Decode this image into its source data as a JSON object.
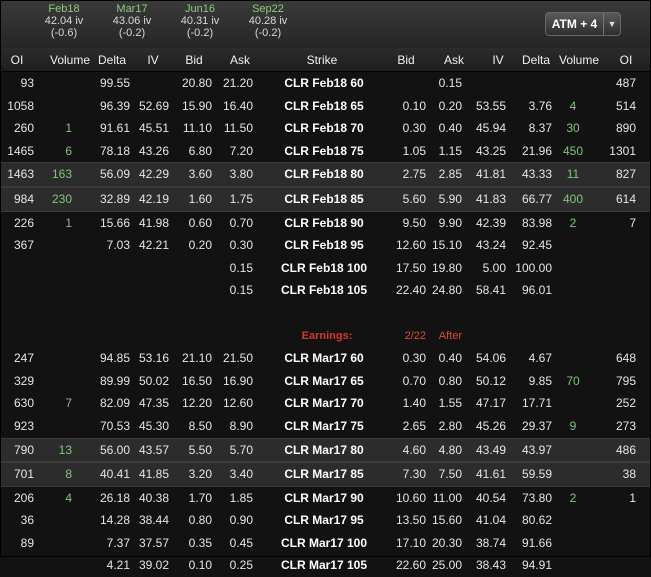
{
  "expirations": [
    {
      "month": "Feb18",
      "iv": "42.04 iv",
      "chg": "(-0.6)"
    },
    {
      "month": "Mar17",
      "iv": "43.06 iv",
      "chg": "(-0.2)"
    },
    {
      "month": "Jun16",
      "iv": "40.31 iv",
      "chg": "(-0.2)"
    },
    {
      "month": "Sep22",
      "iv": "40.28 iv",
      "chg": "(-0.2)"
    }
  ],
  "atm_button": {
    "label": "ATM + 4",
    "arrow": "▼"
  },
  "headers": {
    "oi": "OI",
    "volume": "Volume",
    "delta": "Delta",
    "iv": "IV",
    "bid": "Bid",
    "ask": "Ask",
    "strike": "Strike",
    "pbid": "Bid",
    "pask": "Ask",
    "piv": "IV",
    "pdelta": "Delta",
    "pvolume": "Volume",
    "poi": "OI"
  },
  "earnings": {
    "label": "Earnings:",
    "date": "2/22",
    "when": "After"
  },
  "rows_feb": [
    {
      "oi": "93",
      "vol": "",
      "delta": "99.55",
      "iv": "",
      "bid": "20.80",
      "ask": "21.20",
      "strike": "CLR Feb18 60",
      "pbid": "",
      "pask": "0.15",
      "piv": "",
      "pdelta": "",
      "pvol": "",
      "poi": "487"
    },
    {
      "oi": "1058",
      "vol": "",
      "delta": "96.39",
      "iv": "52.69",
      "bid": "15.90",
      "ask": "16.40",
      "strike": "CLR Feb18 65",
      "pbid": "0.10",
      "pask": "0.20",
      "piv": "53.55",
      "pdelta": "3.76",
      "pvol": "4",
      "poi": "514"
    },
    {
      "oi": "260",
      "vol": "1",
      "delta": "91.61",
      "iv": "45.51",
      "bid": "11.10",
      "ask": "11.50",
      "strike": "CLR Feb18 70",
      "pbid": "0.30",
      "pask": "0.40",
      "piv": "45.94",
      "pdelta": "8.37",
      "pvol": "30",
      "poi": "890"
    },
    {
      "oi": "1465",
      "vol": "6",
      "delta": "78.18",
      "iv": "43.26",
      "bid": "6.80",
      "ask": "7.20",
      "strike": "CLR Feb18 75",
      "pbid": "1.05",
      "pask": "1.15",
      "piv": "43.25",
      "pdelta": "21.96",
      "pvol": "450",
      "poi": "1301"
    },
    {
      "oi": "1463",
      "vol": "163",
      "delta": "56.09",
      "iv": "42.29",
      "bid": "3.60",
      "ask": "3.80",
      "strike": "CLR Feb18 80",
      "pbid": "2.75",
      "pask": "2.85",
      "piv": "41.81",
      "pdelta": "43.33",
      "pvol": "11",
      "poi": "827",
      "hl": true
    },
    {
      "oi": "984",
      "vol": "230",
      "delta": "32.89",
      "iv": "42.19",
      "bid": "1.60",
      "ask": "1.75",
      "strike": "CLR Feb18 85",
      "pbid": "5.60",
      "pask": "5.90",
      "piv": "41.83",
      "pdelta": "66.77",
      "pvol": "400",
      "poi": "614",
      "hl": true
    },
    {
      "oi": "226",
      "vol": "1",
      "delta": "15.66",
      "iv": "41.98",
      "bid": "0.60",
      "ask": "0.70",
      "strike": "CLR Feb18 90",
      "pbid": "9.50",
      "pask": "9.90",
      "piv": "42.39",
      "pdelta": "83.98",
      "pvol": "2",
      "poi": "7"
    },
    {
      "oi": "367",
      "vol": "",
      "delta": "7.03",
      "iv": "42.21",
      "bid": "0.20",
      "ask": "0.30",
      "strike": "CLR Feb18 95",
      "pbid": "12.60",
      "pask": "15.10",
      "piv": "43.24",
      "pdelta": "92.45",
      "pvol": "",
      "poi": ""
    },
    {
      "oi": "",
      "vol": "",
      "delta": "",
      "iv": "",
      "bid": "",
      "ask": "0.15",
      "strike": "CLR Feb18 100",
      "pbid": "17.50",
      "pask": "19.80",
      "piv": "5.00",
      "pdelta": "100.00",
      "pvol": "",
      "poi": ""
    },
    {
      "oi": "",
      "vol": "",
      "delta": "",
      "iv": "",
      "bid": "",
      "ask": "0.15",
      "strike": "CLR Feb18 105",
      "pbid": "22.40",
      "pask": "24.80",
      "piv": "58.41",
      "pdelta": "96.01",
      "pvol": "",
      "poi": ""
    }
  ],
  "rows_mar": [
    {
      "oi": "247",
      "vol": "",
      "delta": "94.85",
      "iv": "53.16",
      "bid": "21.10",
      "ask": "21.50",
      "strike": "CLR Mar17 60",
      "pbid": "0.30",
      "pask": "0.40",
      "piv": "54.06",
      "pdelta": "4.67",
      "pvol": "",
      "poi": "648"
    },
    {
      "oi": "329",
      "vol": "",
      "delta": "89.99",
      "iv": "50.02",
      "bid": "16.50",
      "ask": "16.90",
      "strike": "CLR Mar17 65",
      "pbid": "0.70",
      "pask": "0.80",
      "piv": "50.12",
      "pdelta": "9.85",
      "pvol": "70",
      "poi": "795"
    },
    {
      "oi": "630",
      "vol": "7",
      "delta": "82.09",
      "iv": "47.35",
      "bid": "12.20",
      "ask": "12.60",
      "strike": "CLR Mar17 70",
      "pbid": "1.40",
      "pask": "1.55",
      "piv": "47.17",
      "pdelta": "17.71",
      "pvol": "",
      "poi": "252"
    },
    {
      "oi": "923",
      "vol": "",
      "delta": "70.53",
      "iv": "45.30",
      "bid": "8.50",
      "ask": "8.90",
      "strike": "CLR Mar17 75",
      "pbid": "2.65",
      "pask": "2.80",
      "piv": "45.26",
      "pdelta": "29.37",
      "pvol": "9",
      "poi": "273"
    },
    {
      "oi": "790",
      "vol": "13",
      "delta": "56.00",
      "iv": "43.57",
      "bid": "5.50",
      "ask": "5.70",
      "strike": "CLR Mar17 80",
      "pbid": "4.60",
      "pask": "4.80",
      "piv": "43.49",
      "pdelta": "43.97",
      "pvol": "",
      "poi": "486",
      "hl": true
    },
    {
      "oi": "701",
      "vol": "8",
      "delta": "40.41",
      "iv": "41.85",
      "bid": "3.20",
      "ask": "3.40",
      "strike": "CLR Mar17 85",
      "pbid": "7.30",
      "pask": "7.50",
      "piv": "41.61",
      "pdelta": "59.59",
      "pvol": "",
      "poi": "38",
      "hl": true
    },
    {
      "oi": "206",
      "vol": "4",
      "delta": "26.18",
      "iv": "40.38",
      "bid": "1.70",
      "ask": "1.85",
      "strike": "CLR Mar17 90",
      "pbid": "10.60",
      "pask": "11.00",
      "piv": "40.54",
      "pdelta": "73.80",
      "pvol": "2",
      "poi": "1"
    },
    {
      "oi": "36",
      "vol": "",
      "delta": "14.28",
      "iv": "38.44",
      "bid": "0.80",
      "ask": "0.90",
      "strike": "CLR Mar17 95",
      "pbid": "13.50",
      "pask": "15.60",
      "piv": "41.04",
      "pdelta": "80.62",
      "pvol": "",
      "poi": ""
    },
    {
      "oi": "89",
      "vol": "",
      "delta": "7.37",
      "iv": "37.57",
      "bid": "0.35",
      "ask": "0.45",
      "strike": "CLR Mar17 100",
      "pbid": "17.10",
      "pask": "20.30",
      "piv": "38.74",
      "pdelta": "91.66",
      "pvol": "",
      "poi": ""
    },
    {
      "oi": "",
      "vol": "",
      "delta": "4.21",
      "iv": "39.02",
      "bid": "0.10",
      "ask": "0.25",
      "strike": "CLR Mar17 105",
      "pbid": "22.60",
      "pask": "25.00",
      "piv": "38.43",
      "pdelta": "94.91",
      "pvol": "",
      "poi": ""
    }
  ]
}
